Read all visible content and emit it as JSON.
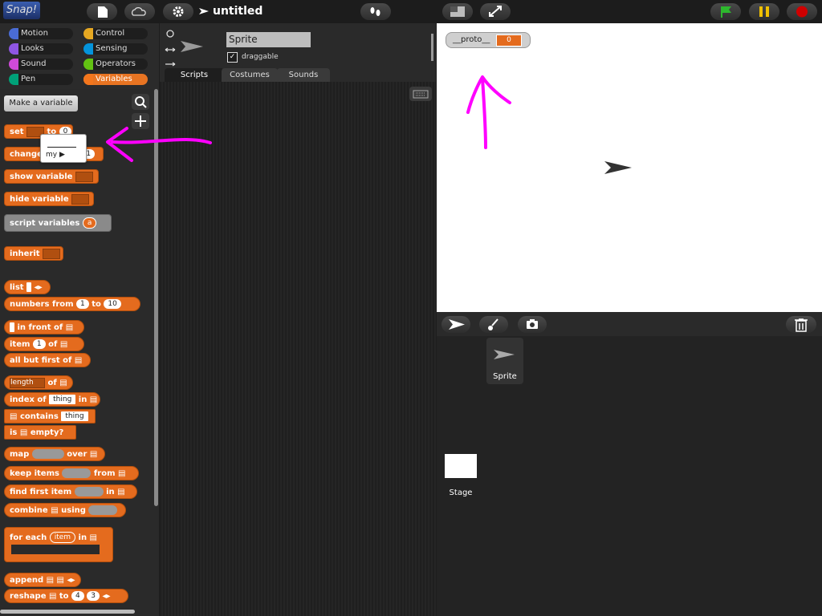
{
  "app": {
    "logo": "Snap!",
    "project_title": "untitled"
  },
  "categories": [
    {
      "label": "Motion",
      "color": "#4a6cd4"
    },
    {
      "label": "Control",
      "color": "#e6a822"
    },
    {
      "label": "Looks",
      "color": "#8f56e3"
    },
    {
      "label": "Sensing",
      "color": "#0494dc"
    },
    {
      "label": "Sound",
      "color": "#cf4ad9"
    },
    {
      "label": "Operators",
      "color": "#62c213"
    },
    {
      "label": "Pen",
      "color": "#00a178"
    },
    {
      "label": "Variables",
      "color": "#f3761d"
    }
  ],
  "palette": {
    "make_variable": "Make a variable",
    "set_prefix": "set",
    "set_to": "to",
    "set_value": "0",
    "change_prefix": "change",
    "change_value": "1",
    "show_variable": "show variable",
    "hide_variable": "hide variable",
    "script_variables": "script variables",
    "script_var": "a",
    "inherit": "inherit",
    "list": "list",
    "numbers_from": "numbers from",
    "numbers_a": "1",
    "numbers_to": "to",
    "numbers_b": "10",
    "in_front_of": "in front of",
    "item": "item",
    "item_value": "1",
    "item_of": "of",
    "all_but_first": "all but first of",
    "length": "length",
    "length_of": "of",
    "index_of": "index of",
    "index_value": "thing",
    "index_in": "in",
    "contains": "contains",
    "contains_value": "thing",
    "is_empty": "is",
    "is_empty_suffix": "empty?",
    "map": "map",
    "map_over": "over",
    "keep_items": "keep items",
    "keep_from": "from",
    "find_first": "find first item",
    "find_in": "in",
    "combine": "combine",
    "combine_using": "using",
    "for_each": "for each",
    "for_each_item": "item",
    "for_each_in": "in",
    "append": "append",
    "reshape": "reshape",
    "reshape_to": "to",
    "reshape_a": "4",
    "reshape_b": "3"
  },
  "popup": {
    "item": "my"
  },
  "sprite": {
    "name": "Sprite",
    "draggable_label": "draggable",
    "draggable_checked": "✓"
  },
  "tabs": [
    "Scripts",
    "Costumes",
    "Sounds"
  ],
  "stage": {
    "watcher_label": "__proto__",
    "watcher_value": "0"
  },
  "corral": {
    "sprite_label": "Sprite",
    "stage_label": "Stage"
  },
  "colors": {
    "accent": "#e46b1e",
    "annotation": "#ff00ff",
    "green_flag": "#2db82d",
    "pause": "#f0c000",
    "stop": "#d00000"
  }
}
